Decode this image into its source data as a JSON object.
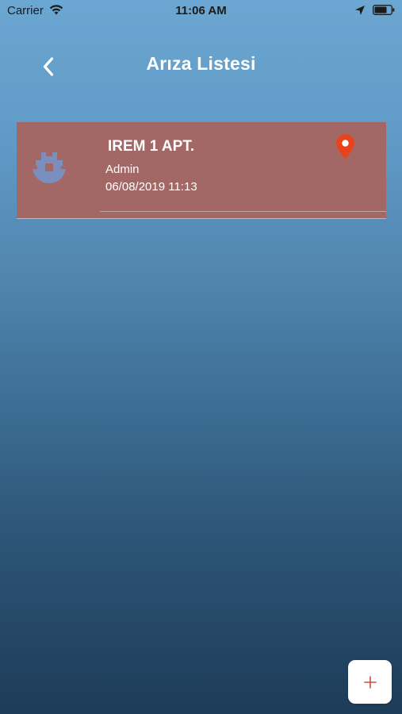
{
  "status_bar": {
    "carrier": "Carrier",
    "time": "11:06 AM"
  },
  "nav": {
    "title": "Arıza Listesi",
    "back_icon": "chevron-left-icon"
  },
  "faults": [
    {
      "title": "IREM 1 APT.",
      "user": "Admin",
      "date": "06/08/2019 11:13",
      "icon": "building-icon",
      "action_icon": "map-pin-icon"
    }
  ],
  "fab": {
    "icon": "plus-icon",
    "icon_color": "#d04a3f"
  },
  "colors": {
    "card_background": "#a36866",
    "pin": "#e8431b",
    "building_icon": "#7b8fbe"
  }
}
